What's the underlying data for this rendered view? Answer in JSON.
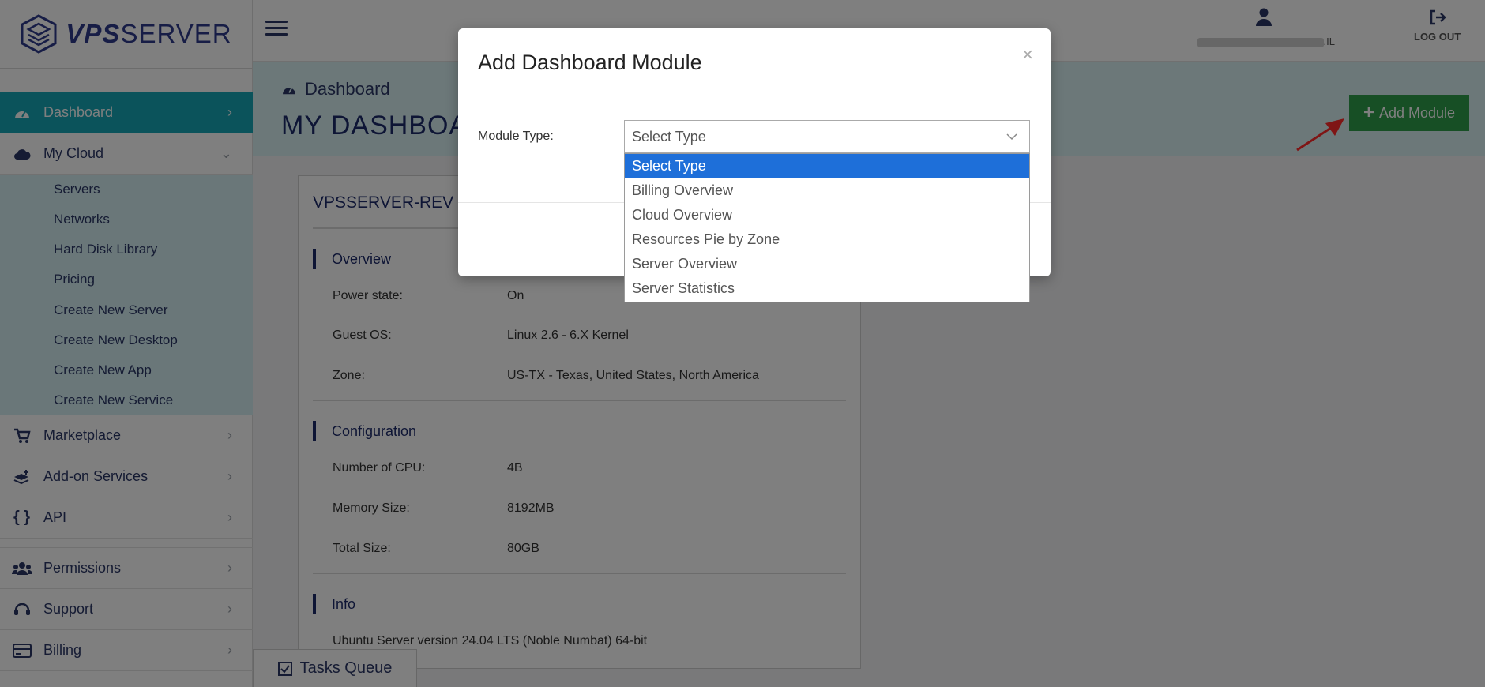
{
  "brand": {
    "logo_bold": "VPS",
    "logo_light": "SERVER"
  },
  "sidebar": {
    "items": [
      {
        "label": "Dashboard",
        "icon": "dashboard-icon",
        "active": true
      },
      {
        "label": "My Cloud",
        "icon": "cloud-icon",
        "expanded": true
      }
    ],
    "my_cloud_sub": [
      "Servers",
      "Networks",
      "Hard Disk Library",
      "Pricing"
    ],
    "create_sub": [
      "Create New Server",
      "Create New Desktop",
      "Create New App",
      "Create New Service"
    ],
    "lower_items": [
      {
        "label": "Marketplace",
        "icon": "cart-icon"
      },
      {
        "label": "Add-on Services",
        "icon": "layers-plus-icon"
      },
      {
        "label": "API",
        "icon": "braces-icon"
      }
    ],
    "bottom_items": [
      {
        "label": "Permissions",
        "icon": "users-icon"
      },
      {
        "label": "Support",
        "icon": "headset-icon"
      },
      {
        "label": "Billing",
        "icon": "credit-card-icon"
      }
    ]
  },
  "topbar": {
    "email_suffix": ".IL",
    "logout_label": "LOG OUT"
  },
  "page": {
    "breadcrumb": "Dashboard",
    "title": "MY DASHBOARD",
    "add_module_label": "Add Module"
  },
  "card": {
    "title": "VPSSERVER-REV",
    "overview_title": "Overview",
    "overview": [
      {
        "label": "Power state:",
        "value": "On"
      },
      {
        "label": "Guest OS:",
        "value": "Linux 2.6 - 6.X Kernel"
      },
      {
        "label": "Zone:",
        "value": "US-TX - Texas, United States, North America"
      }
    ],
    "config_title": "Configuration",
    "config": [
      {
        "label": "Number of CPU:",
        "value": "4B"
      },
      {
        "label": "Memory Size:",
        "value": "8192MB"
      },
      {
        "label": "Total Size:",
        "value": "80GB"
      }
    ],
    "info_title": "Info",
    "info_text": "Ubuntu Server version 24.04 LTS (Noble Numbat) 64-bit"
  },
  "tasks": {
    "label": "Tasks Queue"
  },
  "modal": {
    "title": "Add Dashboard Module",
    "close": "×",
    "field_label": "Module Type:",
    "select_value": "Select Type",
    "options": [
      "Select Type",
      "Billing Overview",
      "Cloud Overview",
      "Resources Pie by Zone",
      "Server Overview",
      "Server Statistics"
    ],
    "selected_index": 0
  },
  "colors": {
    "accent": "#16a6b6",
    "add_button": "#2e9e4a",
    "option_highlight": "#1e6fd9",
    "navy": "#1c2a6b"
  }
}
